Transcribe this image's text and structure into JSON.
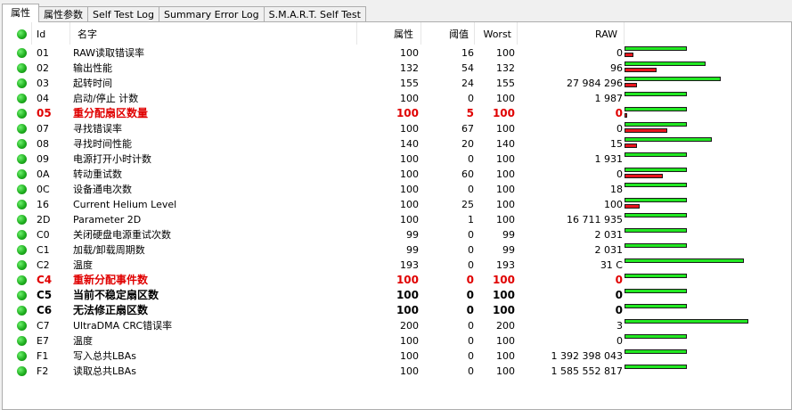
{
  "tabs": [
    "属性",
    "属性参数",
    "Self Test Log",
    "Summary Error Log",
    "S.M.A.R.T. Self Test"
  ],
  "headers": {
    "id": "Id",
    "name": "名字",
    "value": "属性",
    "threshold": "阈值",
    "worst": "Worst",
    "raw": "RAW"
  },
  "colors": {
    "status_ok": "#22b522",
    "bar_green": "#22e822",
    "bar_red": "#e8141e",
    "critical_text": "#e00000"
  },
  "rows": [
    {
      "id": "01",
      "name": "RAW读取错误率",
      "value": "100",
      "threshold": "16",
      "worst": "100",
      "raw": "0",
      "style": "",
      "green_bar": 0.29,
      "red_bar": 0.04
    },
    {
      "id": "02",
      "name": "输出性能",
      "value": "132",
      "threshold": "54",
      "worst": "132",
      "raw": "96",
      "style": "",
      "green_bar": 0.38,
      "red_bar": 0.15
    },
    {
      "id": "03",
      "name": "起转时间",
      "value": "155",
      "threshold": "24",
      "worst": "155",
      "raw": "27 984 296",
      "style": "",
      "green_bar": 0.45,
      "red_bar": 0.06
    },
    {
      "id": "04",
      "name": "启动/停止 计数",
      "value": "100",
      "threshold": "0",
      "worst": "100",
      "raw": "1 987",
      "style": "",
      "green_bar": 0.29,
      "red_bar": 0
    },
    {
      "id": "05",
      "name": "重分配扇区数量",
      "value": "100",
      "threshold": "5",
      "worst": "100",
      "raw": "0",
      "style": "crit",
      "green_bar": 0.29,
      "red_bar": 0.01
    },
    {
      "id": "07",
      "name": "寻找错误率",
      "value": "100",
      "threshold": "67",
      "worst": "100",
      "raw": "0",
      "style": "",
      "green_bar": 0.29,
      "red_bar": 0.2
    },
    {
      "id": "08",
      "name": "寻找时间性能",
      "value": "140",
      "threshold": "20",
      "worst": "140",
      "raw": "15",
      "style": "",
      "green_bar": 0.41,
      "red_bar": 0.06
    },
    {
      "id": "09",
      "name": "电源打开小时计数",
      "value": "100",
      "threshold": "0",
      "worst": "100",
      "raw": "1 931",
      "style": "",
      "green_bar": 0.29,
      "red_bar": 0
    },
    {
      "id": "0A",
      "name": "转动重试数",
      "value": "100",
      "threshold": "60",
      "worst": "100",
      "raw": "0",
      "style": "",
      "green_bar": 0.29,
      "red_bar": 0.18
    },
    {
      "id": "0C",
      "name": "设备通电次数",
      "value": "100",
      "threshold": "0",
      "worst": "100",
      "raw": "18",
      "style": "",
      "green_bar": 0.29,
      "red_bar": 0
    },
    {
      "id": "16",
      "name": "Current Helium Level",
      "value": "100",
      "threshold": "25",
      "worst": "100",
      "raw": "100",
      "style": "",
      "green_bar": 0.29,
      "red_bar": 0.07
    },
    {
      "id": "2D",
      "name": "Parameter 2D",
      "value": "100",
      "threshold": "1",
      "worst": "100",
      "raw": "16 711 935",
      "style": "",
      "green_bar": 0.29,
      "red_bar": 0
    },
    {
      "id": "C0",
      "name": "关闭硬盘电源重试次数",
      "value": "99",
      "threshold": "0",
      "worst": "99",
      "raw": "2 031",
      "style": "",
      "green_bar": 0.29,
      "red_bar": 0
    },
    {
      "id": "C1",
      "name": "加载/卸载周期数",
      "value": "99",
      "threshold": "0",
      "worst": "99",
      "raw": "2 031",
      "style": "",
      "green_bar": 0.29,
      "red_bar": 0
    },
    {
      "id": "C2",
      "name": "温度",
      "value": "193",
      "threshold": "0",
      "worst": "193",
      "raw": "31 C",
      "style": "",
      "green_bar": 0.56,
      "red_bar": 0
    },
    {
      "id": "C4",
      "name": "重新分配事件数",
      "value": "100",
      "threshold": "0",
      "worst": "100",
      "raw": "0",
      "style": "crit",
      "green_bar": 0.29,
      "red_bar": 0
    },
    {
      "id": "C5",
      "name": "当前不稳定扇区数",
      "value": "100",
      "threshold": "0",
      "worst": "100",
      "raw": "0",
      "style": "bold",
      "green_bar": 0.29,
      "red_bar": 0
    },
    {
      "id": "C6",
      "name": "无法修正扇区数",
      "value": "100",
      "threshold": "0",
      "worst": "100",
      "raw": "0",
      "style": "bold",
      "green_bar": 0.29,
      "red_bar": 0
    },
    {
      "id": "C7",
      "name": "UltraDMA CRC错误率",
      "value": "200",
      "threshold": "0",
      "worst": "200",
      "raw": "3",
      "style": "",
      "green_bar": 0.58,
      "red_bar": 0
    },
    {
      "id": "E7",
      "name": "温度",
      "value": "100",
      "threshold": "0",
      "worst": "100",
      "raw": "0",
      "style": "",
      "green_bar": 0.29,
      "red_bar": 0
    },
    {
      "id": "F1",
      "name": "写入总共LBAs",
      "value": "100",
      "threshold": "0",
      "worst": "100",
      "raw": "1 392 398 043",
      "style": "",
      "green_bar": 0.29,
      "red_bar": 0
    },
    {
      "id": "F2",
      "name": "读取总共LBAs",
      "value": "100",
      "threshold": "0",
      "worst": "100",
      "raw": "1 585 552 817",
      "style": "",
      "green_bar": 0.29,
      "red_bar": 0
    }
  ]
}
